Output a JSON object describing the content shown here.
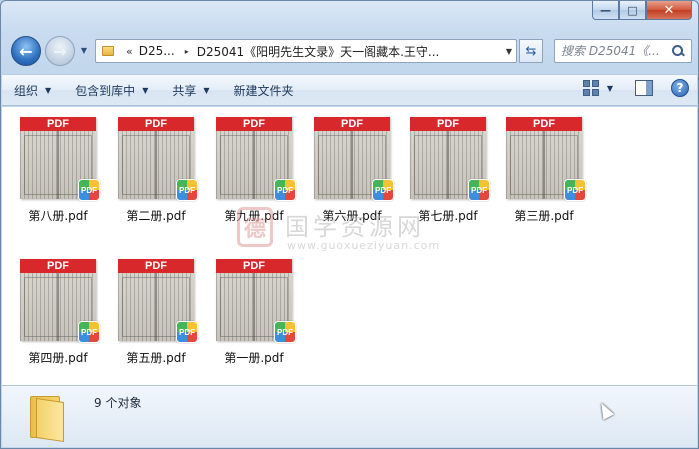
{
  "window": {
    "caption_buttons": {
      "minimize": "—",
      "maximize": "□",
      "close": "✕"
    }
  },
  "nav": {
    "back_glyph": "←",
    "forward_glyph": "→",
    "dropdown_glyph": "▼"
  },
  "address": {
    "overflow_chevron": "«",
    "segment1": "D25...",
    "separator": "▸",
    "segment2": "D25041《阳明先生文录》天一阁藏本.王守...",
    "dropdown_glyph": "▼",
    "refresh_glyph": "⇆"
  },
  "search": {
    "placeholder": "搜索 D25041《..."
  },
  "toolbar": {
    "organize": "组织",
    "include_in_library": "包含到库中",
    "share": "共享",
    "new_folder": "新建文件夹",
    "caret": "▼",
    "help": "?"
  },
  "files": [
    {
      "name": "第八册.pdf",
      "thumb_label": "PDF",
      "badge": "PDF"
    },
    {
      "name": "第二册.pdf",
      "thumb_label": "PDF",
      "badge": "PDF"
    },
    {
      "name": "第九册.pdf",
      "thumb_label": "PDF",
      "badge": "PDF"
    },
    {
      "name": "第六册.pdf",
      "thumb_label": "PDF",
      "badge": "PDF"
    },
    {
      "name": "第七册.pdf",
      "thumb_label": "PDF",
      "badge": "PDF"
    },
    {
      "name": "第三册.pdf",
      "thumb_label": "PDF",
      "badge": "PDF"
    },
    {
      "name": "第四册.pdf",
      "thumb_label": "PDF",
      "badge": "PDF"
    },
    {
      "name": "第五册.pdf",
      "thumb_label": "PDF",
      "badge": "PDF"
    },
    {
      "name": "第一册.pdf",
      "thumb_label": "PDF",
      "badge": "PDF"
    }
  ],
  "watermark": {
    "seal": "德",
    "title": "国学资源网",
    "url": "www.guoxueziyuan.com"
  },
  "status": {
    "count_text": "9 个对象"
  }
}
